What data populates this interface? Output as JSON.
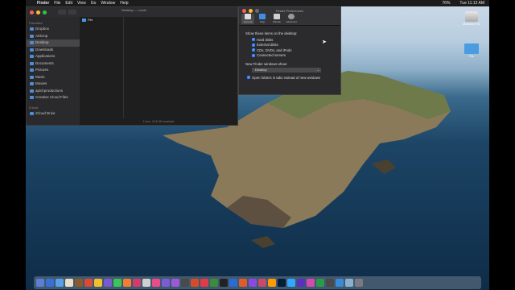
{
  "menubar": {
    "app": "Finder",
    "items": [
      "File",
      "Edit",
      "View",
      "Go",
      "Window",
      "Help"
    ],
    "status": [
      "76%",
      "Tue 11:12 AM"
    ]
  },
  "finder_window": {
    "title": "Desktop — Local",
    "sidebar": {
      "favorites_label": "Favorites",
      "favorites": [
        "Dropbox",
        "AirDrop",
        "Desktop",
        "Downloads",
        "Applications",
        "Documents",
        "Pictures",
        "Music",
        "Movies",
        "apichproductions",
        "Creative Cloud Files"
      ],
      "selected_index": 2,
      "icloud_label": "iCloud",
      "icloud": [
        "iCloud Drive"
      ]
    },
    "files": [
      "File"
    ],
    "status": "1 item, 24.8 GB available"
  },
  "prefs_window": {
    "title": "Finder Preferences",
    "tabs": [
      "General",
      "Tags",
      "Sidebar",
      "Advanced"
    ],
    "show_items_label": "Show these items on the desktop:",
    "checkboxes": [
      {
        "label": "Hard disks",
        "checked": true
      },
      {
        "label": "External disks",
        "checked": true
      },
      {
        "label": "CDs, DVDs, and iPods",
        "checked": true
      },
      {
        "label": "Connected servers",
        "checked": true
      }
    ],
    "new_window_label": "New Finder windows show:",
    "new_window_value": "Desktop",
    "tabs_option": {
      "label": "Open folders in tabs instead of new windows",
      "checked": true
    }
  },
  "desktop_icons": [
    {
      "label": "Macintosh HD",
      "kind": "hard-drive"
    },
    {
      "label": "File",
      "kind": "folder"
    }
  ],
  "dock_colors": [
    "#5b7fd6",
    "#3a6fd8",
    "#5aa0e8",
    "#e8e0c8",
    "#8b5a2b",
    "#d84a3a",
    "#f0c030",
    "#7a5ad0",
    "#3cc35a",
    "#f08030",
    "#d23b6b",
    "#d0d0d0",
    "#ea4c89",
    "#7c5cd6",
    "#9b59d6",
    "#4a4a4a",
    "#d74a2a",
    "#e33a4a",
    "#3c8c3c",
    "#222222",
    "#2a6bd8",
    "#e05a2a",
    "#8a4ae0",
    "#c84a6a",
    "#ff9a00",
    "#001e36",
    "#31a8ff",
    "#5a30c0",
    "#d64ab0",
    "#2b9a4a",
    "#4a4a4a",
    "#3a8ad8",
    "#8ab0d0",
    "#7a7a80"
  ]
}
